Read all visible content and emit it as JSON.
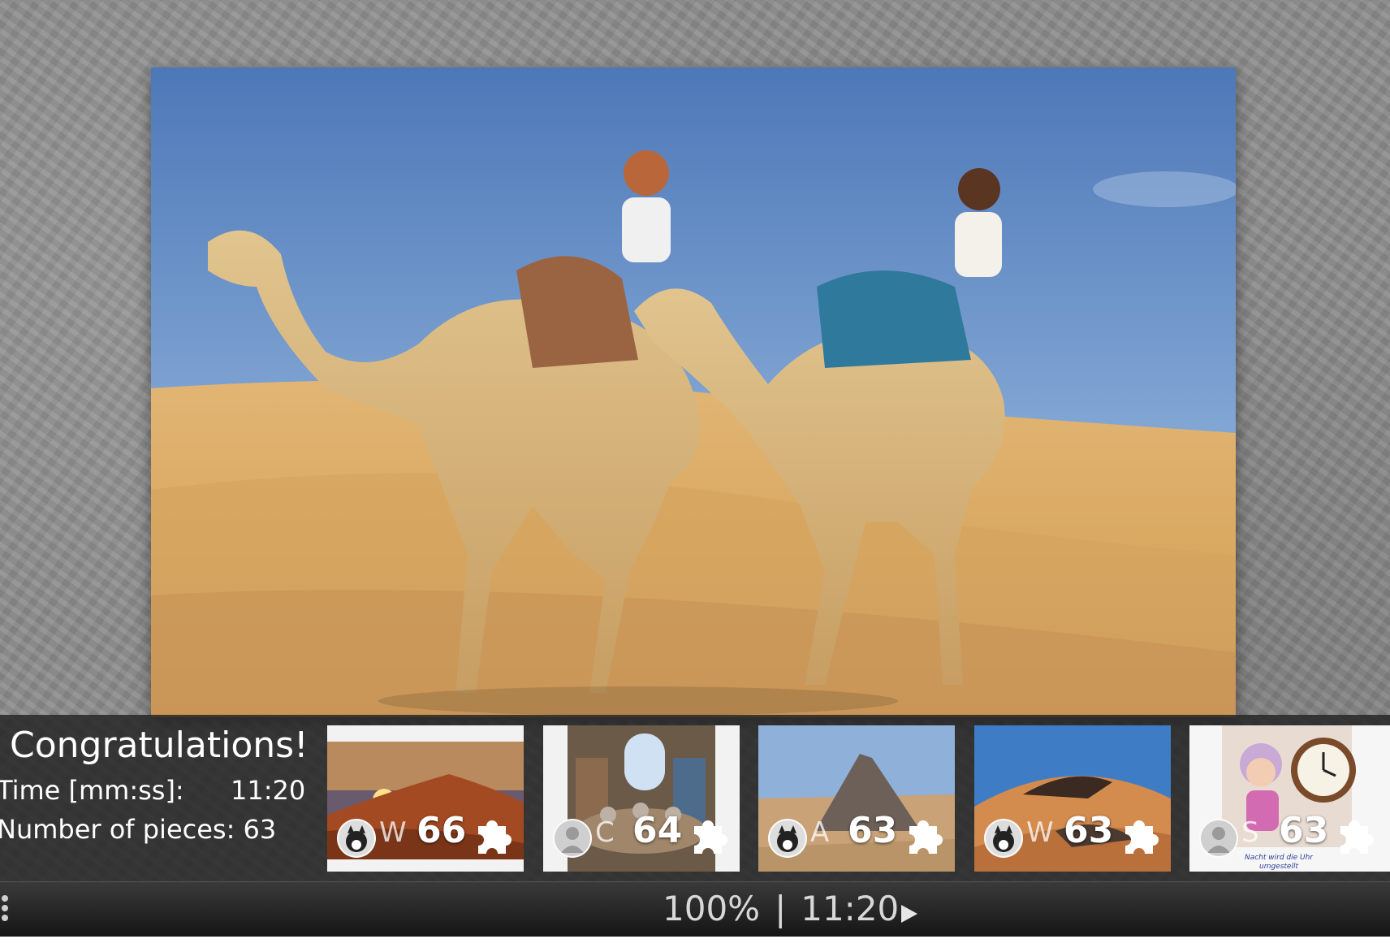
{
  "congrats": {
    "title": "Congratulations!",
    "time_label": "Time [mm:ss]:",
    "time_value": "11:20",
    "pieces_label": "Number of pieces: 63"
  },
  "thumbnails": [
    {
      "initial": "W",
      "count": "66",
      "avatar": "cat-avatar-icon"
    },
    {
      "initial": "C",
      "count": "64",
      "avatar": "default-user-avatar-icon"
    },
    {
      "initial": "A",
      "count": "63",
      "avatar": "cat-avatar-icon"
    },
    {
      "initial": "W",
      "count": "63",
      "avatar": "cat-avatar-icon"
    },
    {
      "initial": "S",
      "count": "63",
      "avatar": "default-user-avatar-icon",
      "caption": "Nacht wird die Uhr umgestellt"
    }
  ],
  "statusbar": {
    "zoom": "100%",
    "separator": "|",
    "time": "11:20"
  },
  "colors": {
    "background": "#8d8d8d",
    "panel": "#222222",
    "statusbar": "#1c1c1c",
    "text": "#ffffff"
  }
}
